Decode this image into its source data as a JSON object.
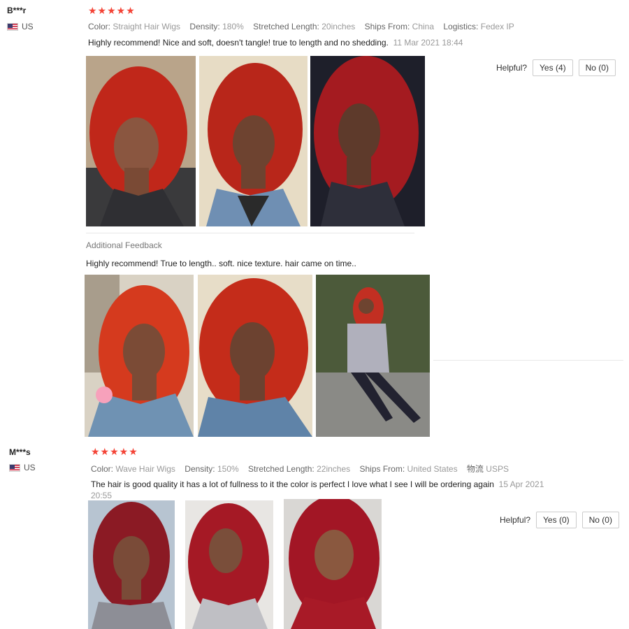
{
  "reviews": [
    {
      "user": "B***r",
      "country": "US",
      "stars": "★★★★★",
      "attrs": [
        {
          "label": "Color:",
          "value": "Straight Hair Wigs"
        },
        {
          "label": "Density:",
          "value": "180%"
        },
        {
          "label": "Stretched Length:",
          "value": "20inches"
        },
        {
          "label": "Ships From:",
          "value": "China"
        },
        {
          "label": "Logistics:",
          "value": "Fedex IP"
        }
      ],
      "text": "Highly recommend! Nice and soft, doesn't tangle! true to length and no shedding.",
      "date": "11 Mar 2021 18:44",
      "helpful_label": "Helpful?",
      "yes": "Yes (4)",
      "no": "No (0)",
      "additional": {
        "title": "Additional Feedback",
        "text": "Highly recommend! True to length.. soft. nice texture. hair came on time.."
      }
    },
    {
      "user": "M***s",
      "country": "US",
      "stars": "★★★★★",
      "attrs": [
        {
          "label": "Color:",
          "value": "Wave Hair Wigs"
        },
        {
          "label": "Density:",
          "value": "150%"
        },
        {
          "label": "Stretched Length:",
          "value": "22inches"
        },
        {
          "label": "Ships From:",
          "value": "United States"
        },
        {
          "label": "物流",
          "value": "USPS"
        }
      ],
      "text": "The hair is good quality it has a lot of fullness to it the color is perfect I love what I see I will be ordering again",
      "date": "15 Apr 2021 20:55",
      "helpful_label": "Helpful?",
      "yes": "Yes (0)",
      "no": "No (0)"
    }
  ],
  "colors": {
    "star": "#f44336",
    "hair": "#c6261b",
    "skin": "#7a4a35"
  }
}
